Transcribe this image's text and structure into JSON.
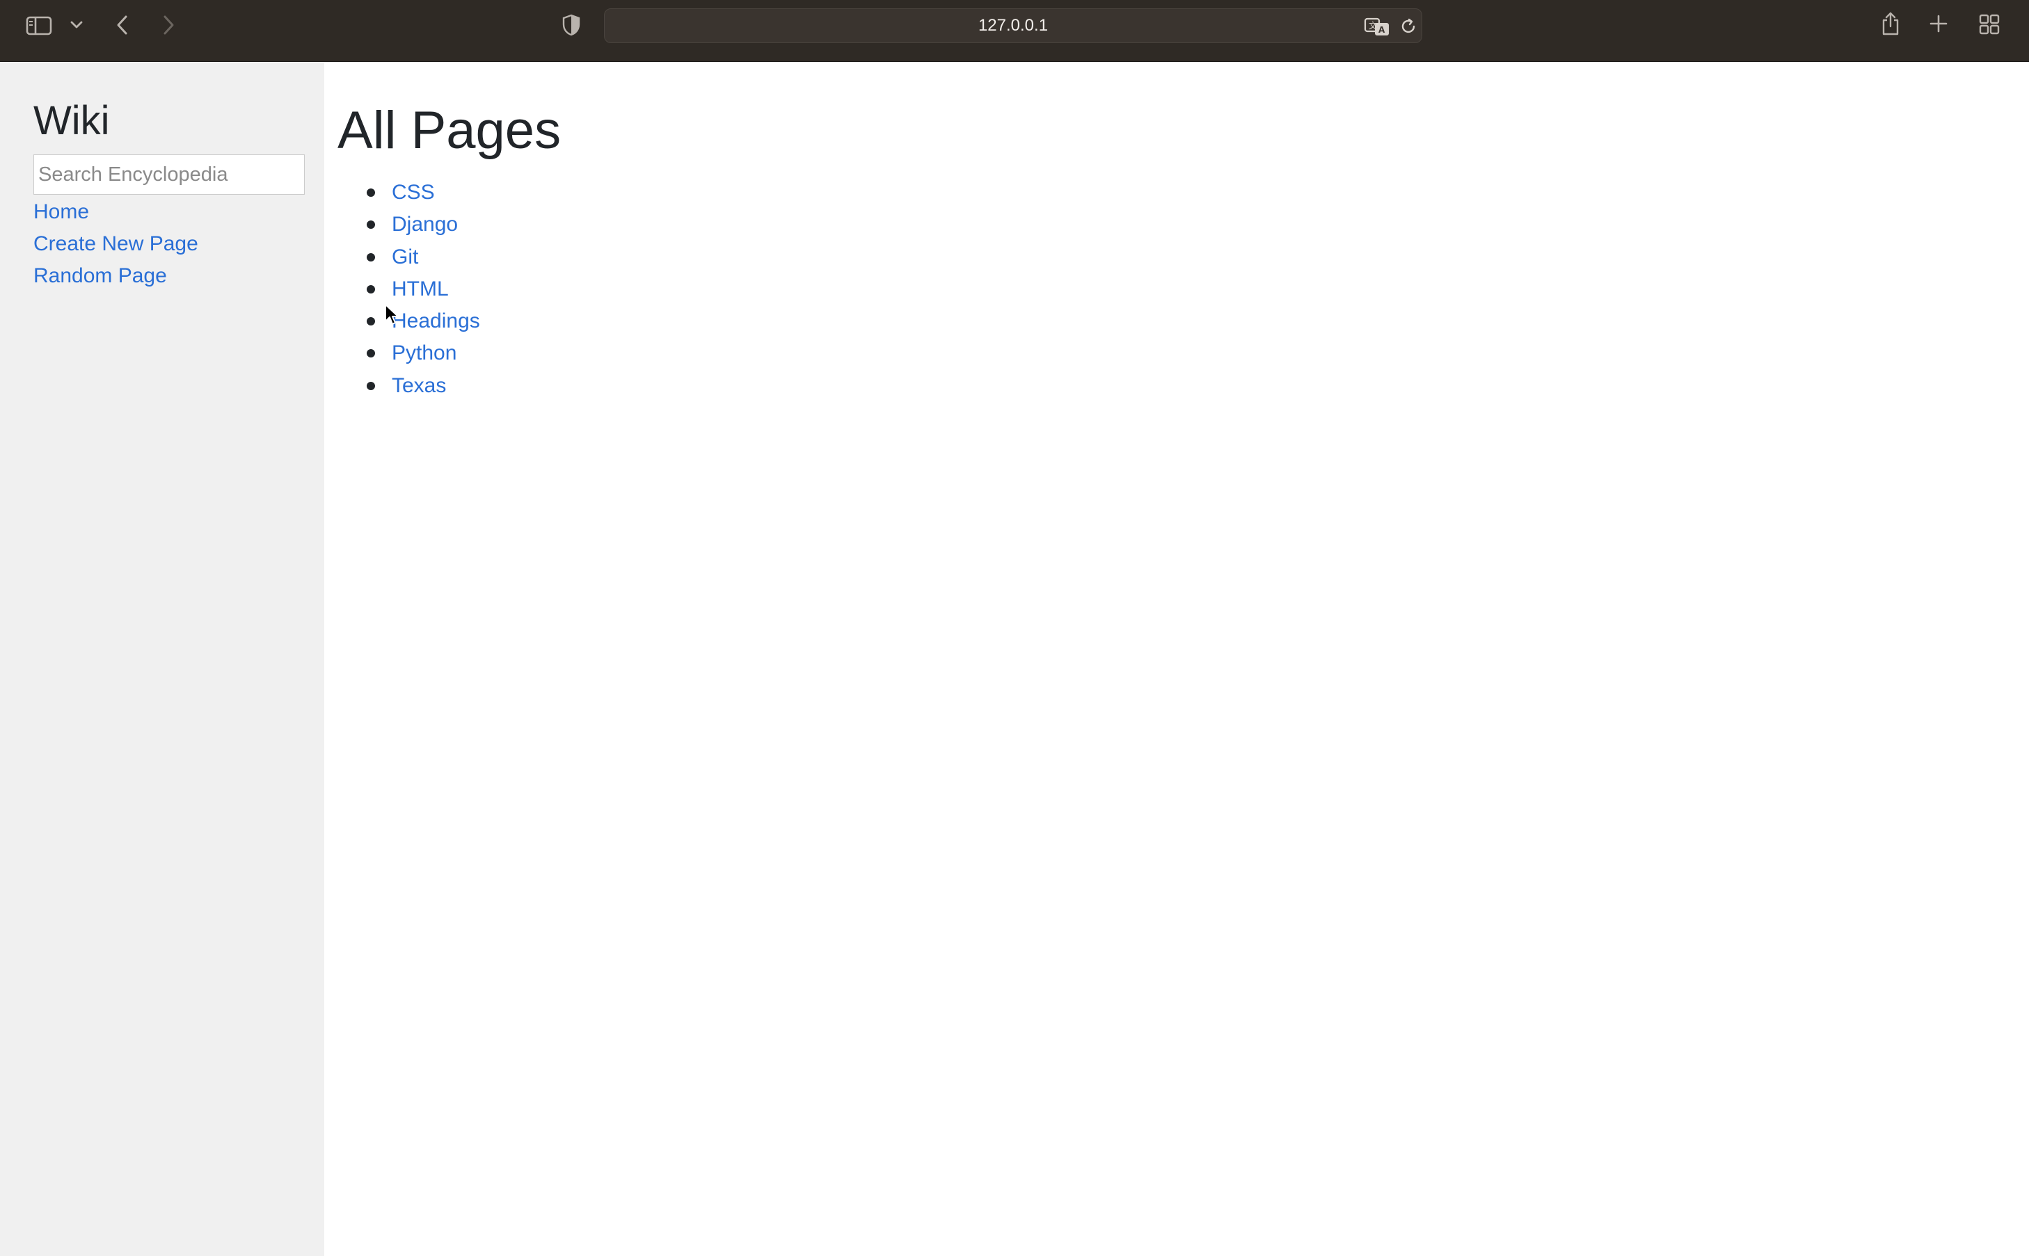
{
  "browser": {
    "url": "127.0.0.1"
  },
  "sidebar": {
    "title": "Wiki",
    "search_placeholder": "Search Encyclopedia",
    "links": [
      {
        "label": "Home"
      },
      {
        "label": "Create New Page"
      },
      {
        "label": "Random Page"
      }
    ]
  },
  "main": {
    "title": "All Pages",
    "pages": [
      {
        "label": "CSS"
      },
      {
        "label": "Django"
      },
      {
        "label": "Git"
      },
      {
        "label": "HTML"
      },
      {
        "label": "Headings"
      },
      {
        "label": "Python"
      },
      {
        "label": "Texas"
      }
    ]
  },
  "colors": {
    "toolbar_bg": "#2f2a25",
    "sidebar_bg": "#f0f0f0",
    "link": "#2a6fd6",
    "heading": "#212529"
  },
  "icons": {
    "toolbar": [
      "sidebar-toggle-icon",
      "chevron-down-icon",
      "back-icon",
      "forward-icon",
      "privacy-shield-icon",
      "translate-icon",
      "reload-icon",
      "share-icon",
      "new-tab-icon",
      "tab-overview-icon"
    ],
    "cursor": "mouse-pointer-icon"
  }
}
